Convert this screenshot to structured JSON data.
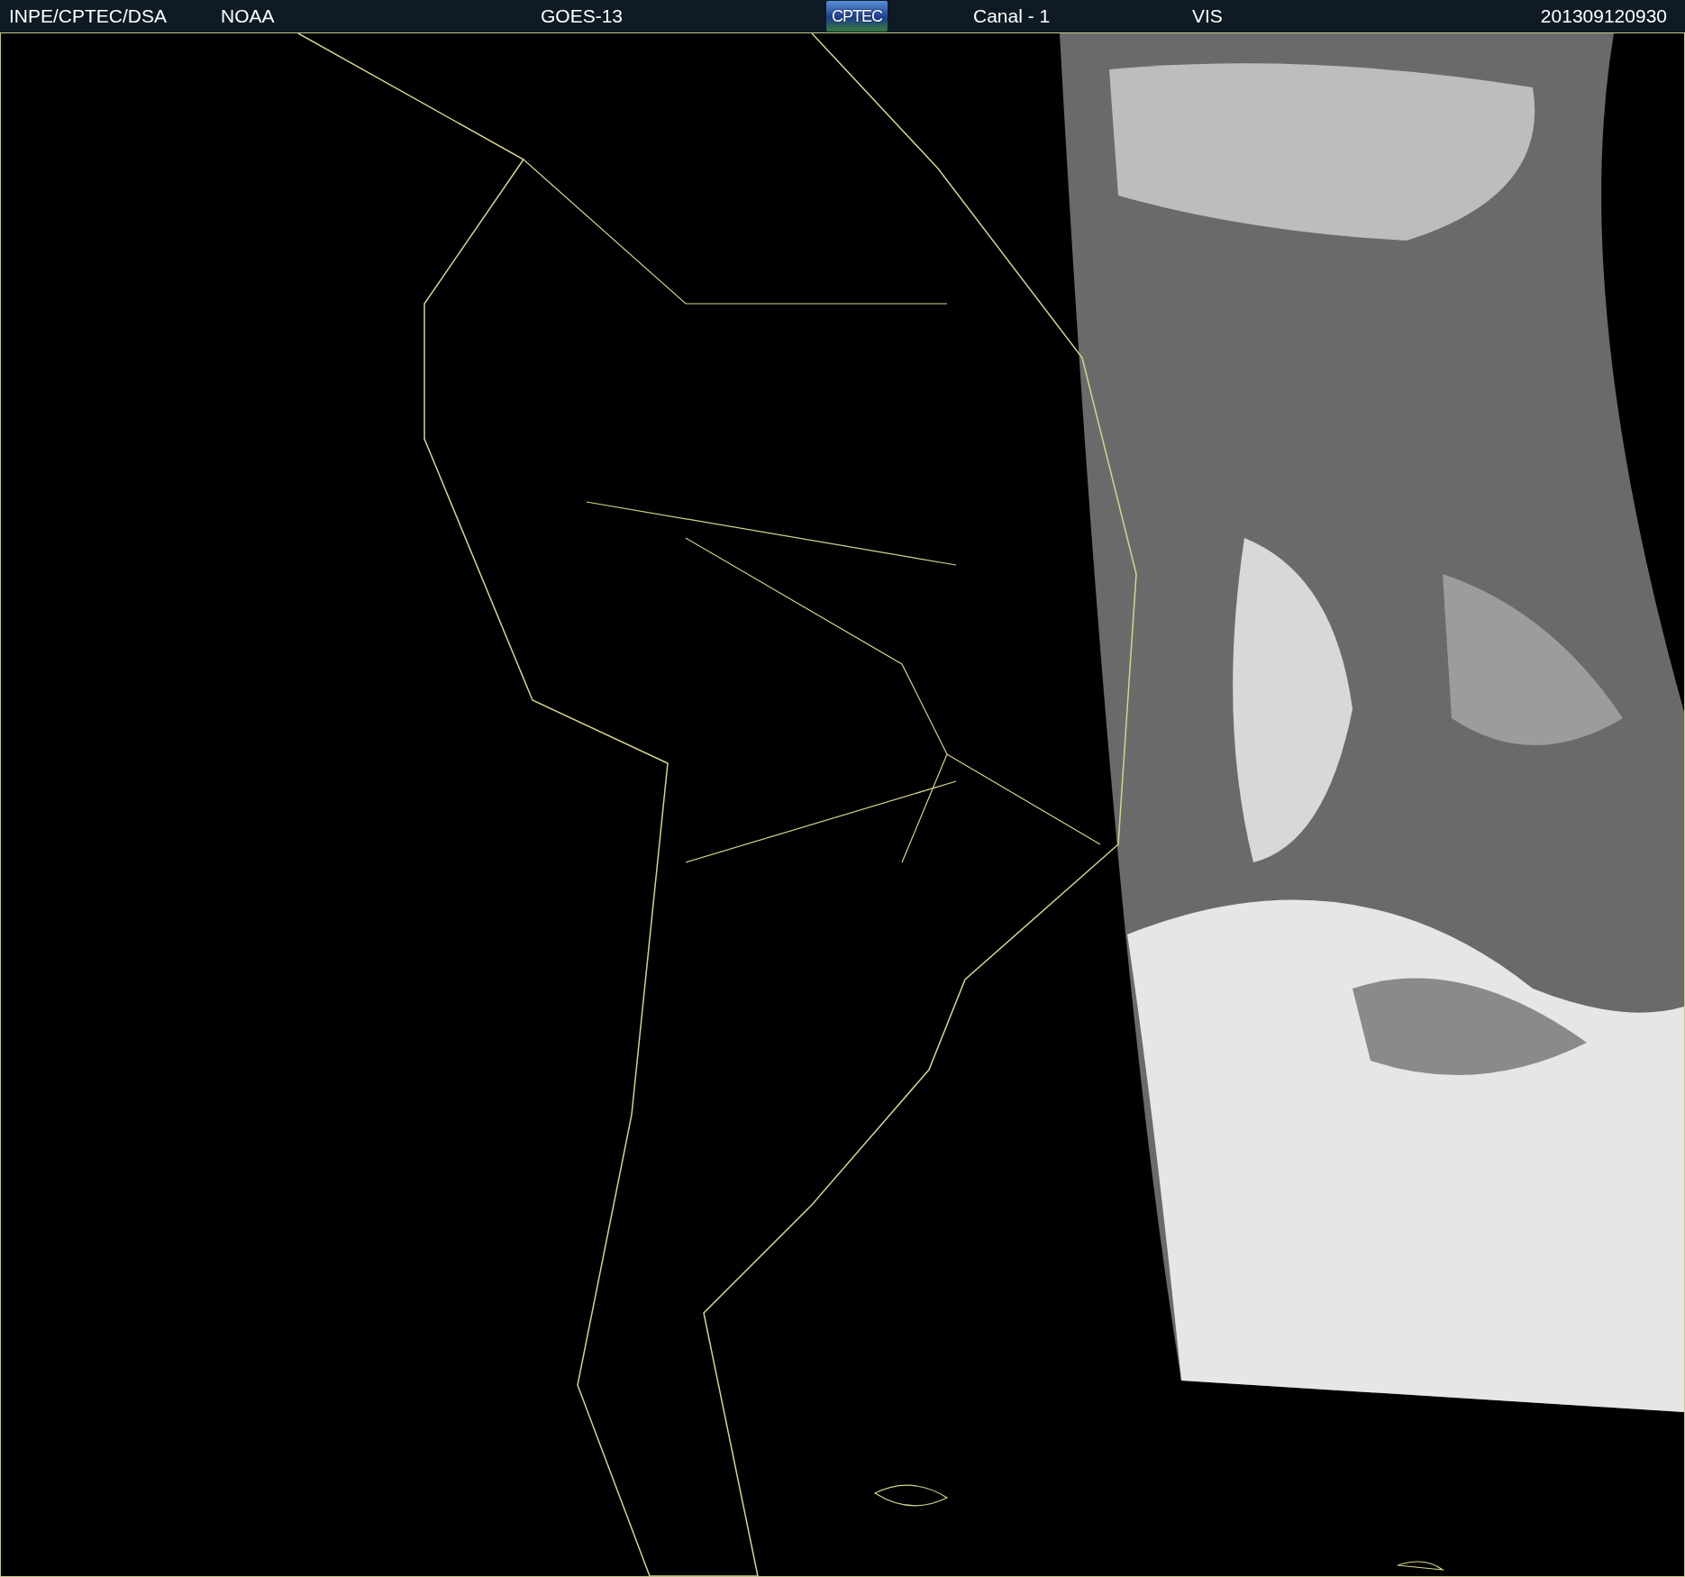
{
  "header": {
    "source": "INPE/CPTEC/DSA",
    "agency": "NOAA",
    "satellite": "GOES-13",
    "logo": "CPTEC",
    "channel": "Canal - 1",
    "band": "VIS",
    "timestamp": "201309120930"
  }
}
